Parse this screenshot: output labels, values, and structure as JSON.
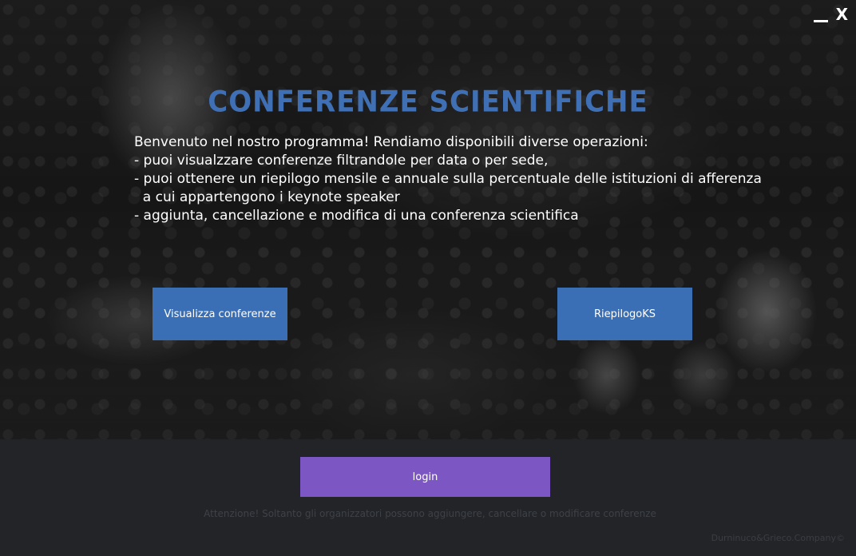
{
  "window_controls": {
    "minimize_label": "",
    "close_label": "X"
  },
  "hero": {
    "title": "CONFERENZE SCIENTIFICHE",
    "intro_lines": [
      "Benvenuto nel nostro programma! Rendiamo disponibili diverse operazioni:",
      "- puoi visualzzare conferenze filtrandole per data o per sede,",
      "- puoi ottenere un riepilogo mensile e annuale sulla percentuale delle istituzioni di afferenza",
      "  a cui appartengono i keynote speaker",
      "- aggiunta, cancellazione e modifica di una conferenza scientifica"
    ]
  },
  "buttons": {
    "visualizza_label": "Visualizza conferenze",
    "riepilogo_label": "RiepilogoKS",
    "login_label": "login"
  },
  "footer": {
    "warning": "Attenzione! Soltanto gli organizzatori possono aggiungere, cancellare o modificare conferenze",
    "copyright": "Durninuco&Grieco.Company©"
  },
  "colors": {
    "title": "#3f6fb5",
    "primary_button": "#3a6fb5",
    "login_button": "#7c57c3",
    "footer_bg": "#222428"
  }
}
